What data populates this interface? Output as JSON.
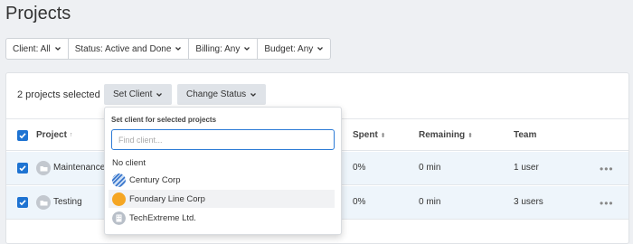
{
  "page": {
    "title": "Projects"
  },
  "filters": [
    {
      "label": "Client: All"
    },
    {
      "label": "Status: Active and Done"
    },
    {
      "label": "Billing: Any"
    },
    {
      "label": "Budget: Any"
    }
  ],
  "bulk": {
    "selected_text": "2 projects selected",
    "set_client_label": "Set Client",
    "change_status_label": "Change Status"
  },
  "table": {
    "columns": {
      "project": "Project",
      "spent": "Spent",
      "remaining": "Remaining",
      "team": "Team"
    },
    "rows": [
      {
        "name": "Maintenance",
        "spent": "0%",
        "remaining": "0 min",
        "team": "1 user",
        "checked": true
      },
      {
        "name": "Testing",
        "spent": "0%",
        "remaining": "0 min",
        "team": "3 users",
        "checked": true
      }
    ]
  },
  "client_dropdown": {
    "title": "Set client for selected projects",
    "search_placeholder": "Find client...",
    "search_value": "",
    "no_client_label": "No client",
    "clients": [
      {
        "name": "Century Corp",
        "icon": "striped-blue-circle",
        "color": "#2f6fc9"
      },
      {
        "name": "Foundary Line Corp",
        "icon": "orange-circle",
        "color": "#f5a623"
      },
      {
        "name": "TechExtreme Ltd.",
        "icon": "building-grey-circle",
        "color": "#b8bfc8"
      }
    ],
    "hovered_index": 1
  },
  "colors": {
    "accent": "#1e73d2",
    "row_selected": "#eef5fb",
    "button_bg": "#dfe3e8"
  }
}
